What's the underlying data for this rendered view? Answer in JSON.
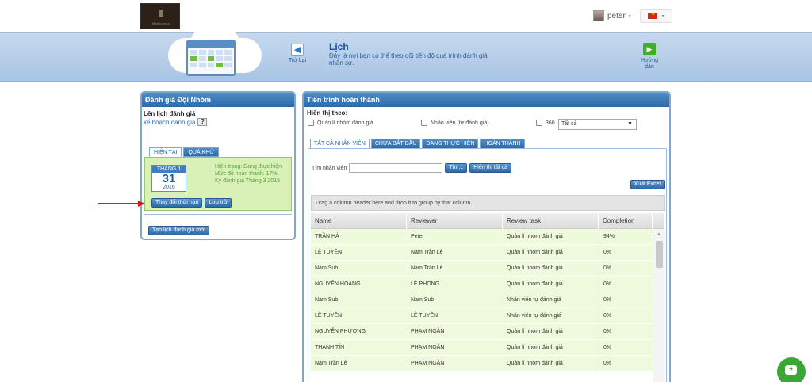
{
  "header": {
    "logo_text": "Maleinbess",
    "user_name": "peter",
    "user_caret": "▾",
    "lang_caret": "▾"
  },
  "banner": {
    "back_label": "Trở Lại",
    "title": "Lịch",
    "description": "Đây là nơi bạn có thể theo dõi tiến độ quá trình đánh giá nhân sự.",
    "guide_label": "Hướng dẫn"
  },
  "left_panel": {
    "title": "Đánh giá Đội Nhóm",
    "schedule_label": "Lên lịch đánh giá",
    "plan_link": "kế hoạch đánh giá",
    "help_mark": "?",
    "tabs": [
      "HIỆN TẠI",
      "QUÁ KHỨ"
    ],
    "calendar": {
      "month": "THÁNG 1",
      "day": "31",
      "year": "2016"
    },
    "status": {
      "line1": "Hiện trạng: Đang thực hiện",
      "line2": "Mức độ hoàn thành: 17%",
      "line3": "Kỳ đánh giá Tháng 3 2015"
    },
    "change_deadline_button": "Thay đổi thời hạn",
    "save_button": "Lưu trữ",
    "new_schedule_button": "Tạo lịch đánh giá mới"
  },
  "right_panel": {
    "title": "Tiến trình hoàn thành",
    "show_by_label": "Hiển thị theo:",
    "filters": {
      "team_manager": "Quản lí nhóm đánh giá",
      "self_employee": "Nhân viên (tự đánh giá)",
      "three_sixty": "360",
      "select_value": "Tất cả"
    },
    "tabs": [
      "TẤT CẢ NHÂN VIÊN",
      "CHƯA BẮT ĐẦU",
      "ĐANG THỰC HIỆN",
      "HOÀN THÀNH"
    ],
    "search_label": "Tìm nhân viên",
    "search_value": "",
    "search_button": "Tìm...",
    "show_all_button": "Hiển thị tất cả",
    "export_button": "Xuất Excel",
    "group_hint": "Drag a column header here and drop it to group by that column.",
    "columns": [
      "Name",
      "Reviewer",
      "Review task",
      "Completion"
    ],
    "rows": [
      [
        "TRẦN HÀ",
        "Peter",
        "Quản lí nhóm đánh giá",
        "94%"
      ],
      [
        "LÊ TUYỀN",
        "Nam Trần Lê",
        "Quản lí nhóm đánh giá",
        "0%"
      ],
      [
        "Nam Sub",
        "Nam Trần Lê",
        "Quản lí nhóm đánh giá",
        "0%"
      ],
      [
        "NGUYỄN HOÀNG",
        "LÊ PHONG",
        "Quản lí nhóm đánh giá",
        "0%"
      ],
      [
        "Nam Sub",
        "Nam Sub",
        "Nhân viên tự đánh giá",
        "0%"
      ],
      [
        "LÊ TUYỀN",
        "LÊ TUYỀN",
        "Nhân viên tự đánh giá",
        "0%"
      ],
      [
        "NGUYỄN PHƯƠNG",
        "PHẠM NGÂN",
        "Quản lí nhóm đánh giá",
        "0%"
      ],
      [
        "THANH TÍN",
        "PHẠM NGÂN",
        "Quản lí nhóm đánh giá",
        "0%"
      ],
      [
        "Nam Trần Lê",
        "PHẠM NGÂN",
        "Quản lí nhóm đánh giá",
        "0%"
      ]
    ]
  },
  "colors": {
    "header_blue": "#2e6aa8",
    "banner_blue": "#b8cfea",
    "row_green": "#eff9dc",
    "arrow_red": "#e0150f",
    "chat_green": "#3aa835"
  }
}
